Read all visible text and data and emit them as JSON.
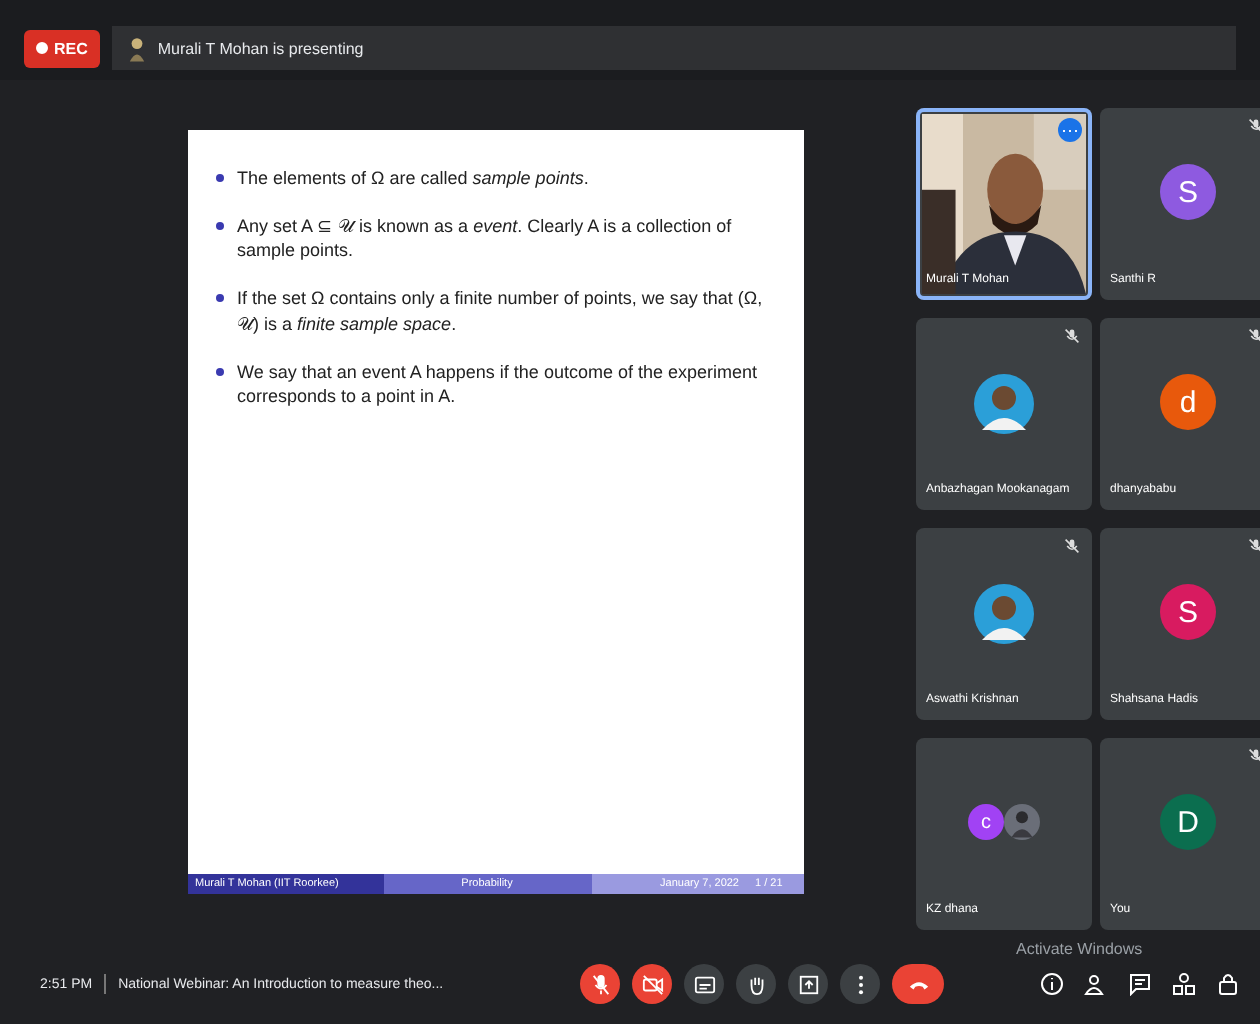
{
  "top_bar": {
    "rec": "REC",
    "presenting": "Murali T Mohan is presenting"
  },
  "slide": {
    "bullets": [
      "The elements of Ω are called *sample points*.",
      "Any set A ⊆ 𝒰 is known as a *event*. Clearly A is a collection of sample points.",
      "If the set Ω contains only a finite number of points, we say that (Ω, 𝒰) is a *finite sample space*.",
      "We say that an event A happens if the outcome of the experiment corresponds to a point in A."
    ],
    "footer": [
      "Murali T Mohan (IIT Roorkee)",
      "Probability",
      "January 7, 2022",
      "1 / 21"
    ]
  },
  "participants": [
    {
      "name": "Murali T Mohan",
      "kind": "video",
      "highlighted": true,
      "muted": false,
      "badge": "⋯"
    },
    {
      "name": "Anbazhagan Mookanagam",
      "highlighted": false,
      "muted": true
    },
    {
      "name": "Aswathi Krishnan",
      "highlighted": false,
      "muted": true
    },
    {
      "name": "KZ dhana",
      "kind": "pair",
      "letter": "c",
      "color": "#a142f4",
      "highlighted": false,
      "muted": false
    },
    {
      "name": "Santhi R",
      "kind": "letter",
      "letter": "S",
      "color": "#8e5ae0",
      "highlighted": false,
      "muted": true
    },
    {
      "name": "dhanyababu",
      "kind": "letter",
      "letter": "d",
      "color": "#e8590c",
      "highlighted": false,
      "muted": true
    },
    {
      "name": "Shahsana Hadis",
      "kind": "letter",
      "letter": "S",
      "color": "#d81b60",
      "highlighted": false,
      "muted": true
    },
    {
      "name": "You",
      "kind": "letter",
      "letter": "D",
      "color": "#0b6e4f",
      "highlighted": false,
      "muted": true
    }
  ],
  "bottom_bar": {
    "time": "2:51 PM",
    "meeting": "National Webinar: An Introduction to measure theo...",
    "overlay": "Activate Windows",
    "controls": [
      {
        "kind": "mic",
        "off": true
      },
      {
        "kind": "cam",
        "off": true
      },
      {
        "kind": "captions",
        "off": false
      },
      {
        "kind": "hand",
        "off": false
      },
      {
        "kind": "present",
        "off": false
      },
      {
        "kind": "more",
        "off": false
      },
      {
        "kind": "end",
        "off": true
      }
    ],
    "side": [
      {
        "kind": "info"
      },
      {
        "kind": "people"
      },
      {
        "kind": "chat"
      },
      {
        "kind": "activities"
      },
      {
        "kind": "lock"
      }
    ]
  }
}
